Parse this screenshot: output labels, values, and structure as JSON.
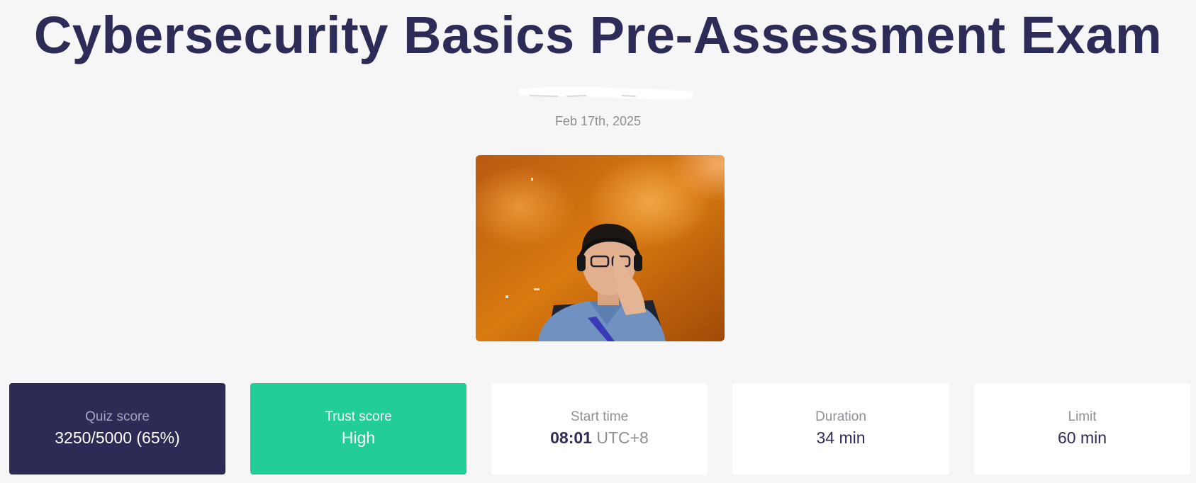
{
  "exam": {
    "title": "Cybersecurity Basics Pre-Assessment Exam",
    "date": "Feb 17th, 2025"
  },
  "stats": {
    "quiz_score": {
      "label": "Quiz score",
      "value": "3250/5000 (65%)"
    },
    "trust_score": {
      "label": "Trust score",
      "value": "High"
    },
    "start_time": {
      "label": "Start time",
      "time": "08:01",
      "zone": "UTC+8"
    },
    "duration": {
      "label": "Duration",
      "value": "34 min"
    },
    "limit": {
      "label": "Limit",
      "value": "60 min"
    }
  },
  "colors": {
    "title": "#2d2b57",
    "quiz_card": "#2d2b55",
    "trust_card": "#23cd97",
    "background": "#f6f6f6"
  }
}
